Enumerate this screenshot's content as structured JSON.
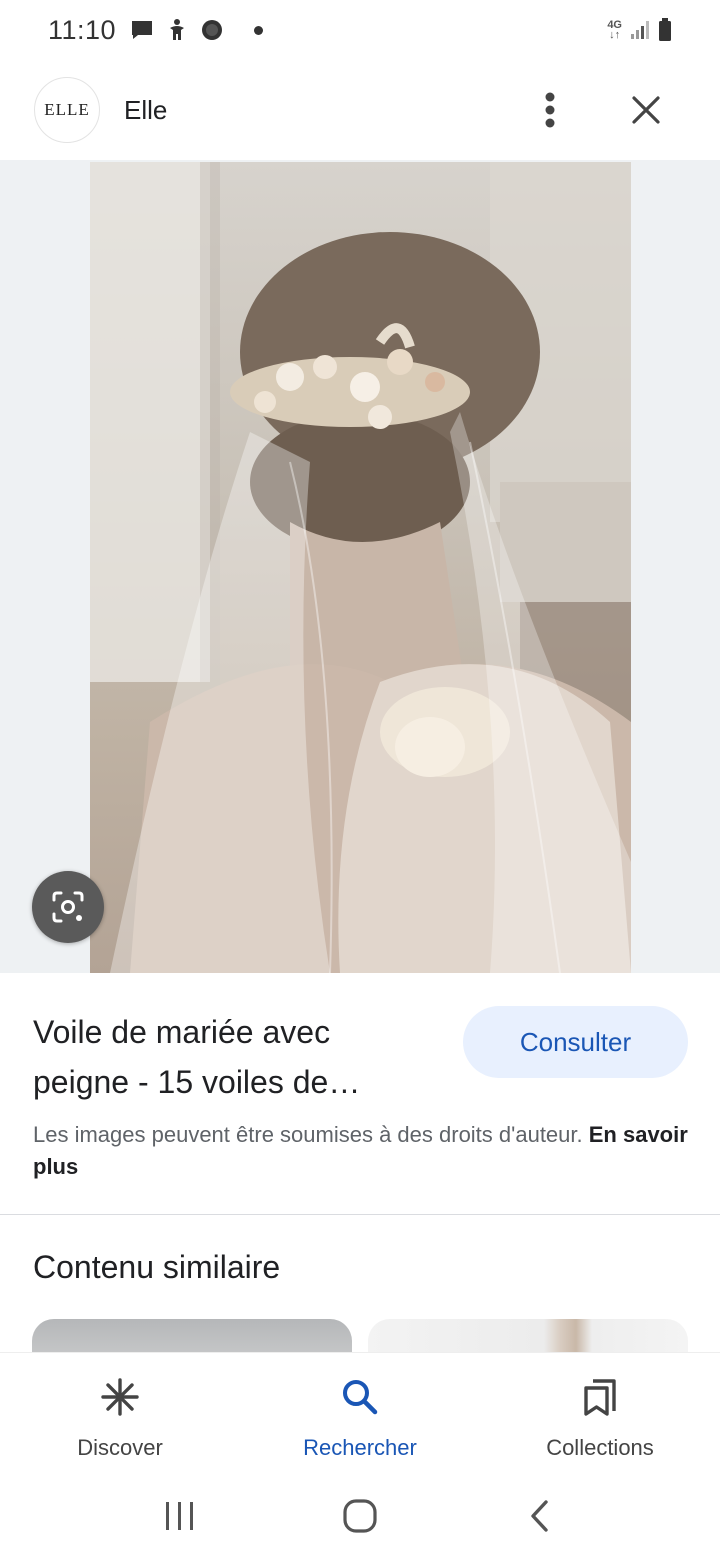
{
  "status_bar": {
    "time": "11:10",
    "network": "4G",
    "icons": [
      "message-icon",
      "accessibility-icon",
      "chat-bubble-icon",
      "dot-icon",
      "signal-icon",
      "battery-icon"
    ]
  },
  "header": {
    "source_logo_text": "ELLE",
    "source_name": "Elle",
    "icons": [
      "more-vert-icon",
      "close-icon"
    ]
  },
  "image": {
    "subject": "bride veil photo",
    "lens_icon": "lens-search-icon"
  },
  "result": {
    "title": "Voile de mariée avec peigne - 15 voiles de…",
    "consult_label": "Consulter",
    "copyright_text": "Les images peuvent être soumises à des droits d'auteur.",
    "copyright_link": "En savoir plus"
  },
  "similar": {
    "heading": "Contenu similaire"
  },
  "bottom_nav": {
    "items": [
      {
        "label": "Discover",
        "icon": "asterisk-icon",
        "active": false
      },
      {
        "label": "Rechercher",
        "icon": "search-icon",
        "active": true
      },
      {
        "label": "Collections",
        "icon": "collections-icon",
        "active": false
      }
    ]
  },
  "colors": {
    "accent": "#1a56b5",
    "button_bg": "#e8f0fe",
    "text_primary": "#202124",
    "text_secondary": "#5f6368"
  }
}
